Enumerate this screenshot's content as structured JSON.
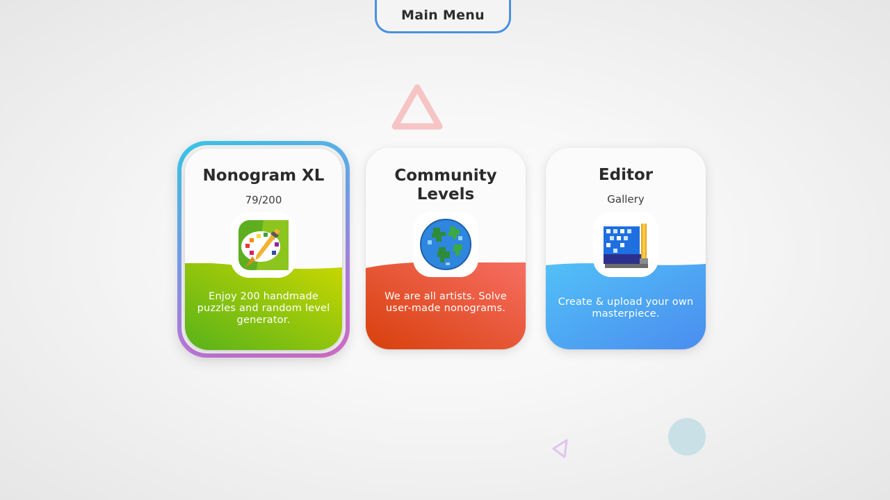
{
  "header": {
    "title": "Main Menu"
  },
  "cards": [
    {
      "title": "Nonogram XL",
      "subtitle": "79/200",
      "description": "Enjoy 200 handmade puzzles and random level generator.",
      "icon": "paint-palette-icon",
      "colors": {
        "from": "#5bb31a",
        "to": "#c8d600"
      },
      "selected": true
    },
    {
      "title": "Community Levels",
      "subtitle": "",
      "description": "We are all artists. Solve user-made nonograms.",
      "icon": "globe-icon",
      "colors": {
        "from": "#d9420d",
        "to": "#f56a5e"
      },
      "selected": false
    },
    {
      "title": "Editor",
      "subtitle": "Gallery",
      "description": "Create & upload your own masterpiece.",
      "icon": "pixel-brush-icon",
      "colors": {
        "from": "#4fb6f5",
        "to": "#4a8ff0"
      },
      "selected": false
    }
  ],
  "decorations": [
    "triangle-outline-icon",
    "small-triangle-outline-icon",
    "circle-blob-icon"
  ]
}
